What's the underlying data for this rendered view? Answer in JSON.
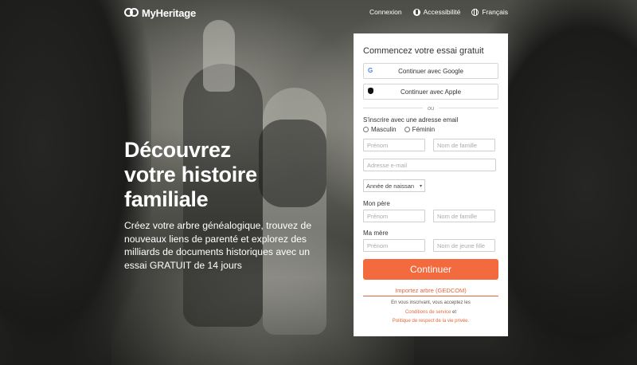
{
  "header": {
    "logo_text": "MyHeritage",
    "nav": {
      "login": "Connexion",
      "accessibility": "Accessibilité",
      "language": "Français"
    }
  },
  "hero": {
    "title_line1": "Découvrez",
    "title_line2": "votre histoire",
    "title_line3": "familiale",
    "subtitle": "Créez votre arbre généalogique, trouvez de nouveaux liens de parenté et explorez des milliards de documents historiques avec un essai GRATUIT de 14 jours"
  },
  "signup": {
    "title": "Commencez votre essai gratuit",
    "google_button": "Continuer avec Google",
    "apple_button": "Continuer avec Apple",
    "or": "ou",
    "email_label": "S'inscrire avec une adresse email",
    "gender_male": "Masculin",
    "gender_female": "Féminin",
    "first_name_placeholder": "Prénom",
    "last_name_placeholder": "Nom de famille",
    "email_placeholder": "Adresse e-mail",
    "birth_year_selected": "Année de naissan",
    "father_label": "Mon père",
    "father_first_placeholder": "Prénom",
    "father_last_placeholder": "Nom de famille",
    "mother_label": "Ma mère",
    "mother_first_placeholder": "Prénom",
    "mother_last_placeholder": "Nom de jeune fille",
    "continue_button": "Continuer",
    "gedcom_link": "Importez arbre (GEDCOM)",
    "terms_text": "En vous inscrivant, vous acceptez les",
    "terms_link": "Conditions de service",
    "terms_and": "et",
    "privacy_link": "Politique de respect de la vie privée."
  },
  "colors": {
    "accent": "#f26a3d",
    "link": "#e3683c",
    "card_bg": "#ffffff"
  },
  "icons": [
    "myheritage-logo-icon",
    "accessibility-icon",
    "globe-icon",
    "google-icon",
    "apple-icon",
    "chevron-down-icon"
  ]
}
